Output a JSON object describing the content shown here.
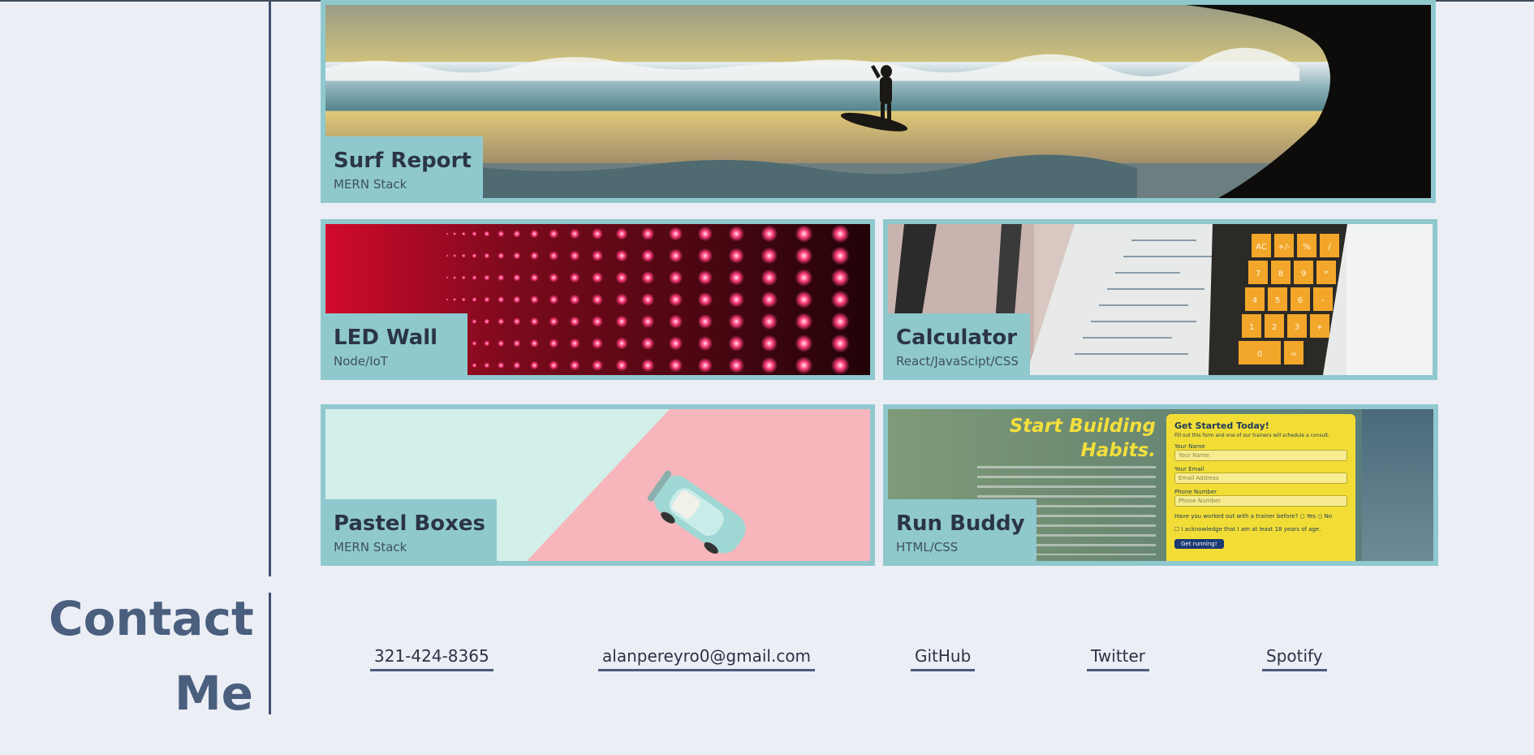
{
  "projects": {
    "surf": {
      "title": "Surf Report",
      "stack": "MERN Stack"
    },
    "led": {
      "title": "LED Wall",
      "stack": "Node/IoT"
    },
    "calc": {
      "title": "Calculator",
      "stack": "React/JavaScipt/CSS",
      "keys": [
        "AC",
        "+/-",
        "%",
        "/",
        "7",
        "8",
        "9",
        "*",
        "4",
        "5",
        "6",
        "-",
        "1",
        "2",
        "3",
        "+",
        "0",
        "",
        "="
      ]
    },
    "pastel": {
      "title": "Pastel Boxes",
      "stack": "MERN Stack"
    },
    "run": {
      "title": "Run Buddy",
      "stack": "HTML/CSS",
      "headline_1": "Start Building",
      "headline_2": "Habits.",
      "form_title": "Get Started Today!",
      "form_sub": "Fill out this form and one of our trainers will schedule a consult.",
      "name_label": "Your Name",
      "name_placeholder": "Your Name",
      "email_label": "Your Email",
      "email_placeholder": "Email Address",
      "phone_label": "Phone Number",
      "phone_placeholder": "Phone Number",
      "trainer_question": "Have you worked out with a trainer before?",
      "yes": "Yes",
      "no": "No",
      "acknowledge": "I acknowledge that I am at least 18 years of age.",
      "submit": "Get running!"
    }
  },
  "contact": {
    "title_line1": "Contact",
    "title_line2": "Me",
    "phone": "321-424-8365",
    "email": "alanpereyro0@gmail.com",
    "github": "GitHub",
    "twitter": "Twitter",
    "spotify": "Spotify"
  },
  "colors": {
    "background": "#eceef6",
    "accent": "#8fc9ce",
    "heading": "#4a5f7e"
  }
}
